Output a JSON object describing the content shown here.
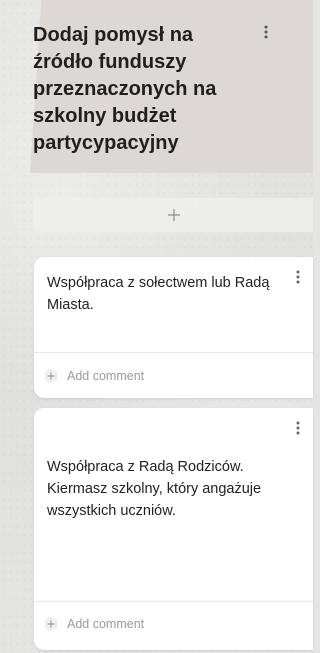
{
  "column": {
    "title": "Dodaj pomysł na źródło funduszy przeznaczonych na szkolny budżet partycypacyjny"
  },
  "add_post": {
    "icon": "plus-icon"
  },
  "cards": [
    {
      "text": "Współpraca z sołectwem lub Radą Miasta.",
      "comment_label": "Add comment"
    },
    {
      "text": "Współpraca z Radą Rodziców. Kiermasz szkolny, który angażuje wszystkich uczniów.",
      "comment_label": "Add comment"
    }
  ],
  "icons": {
    "menu": "more-vertical-icon",
    "add_comment": "circle-plus-icon"
  },
  "colors": {
    "header_bg": "#dcd9d5",
    "card_bg": "#ffffff",
    "muted_text": "#9a9a9a"
  }
}
